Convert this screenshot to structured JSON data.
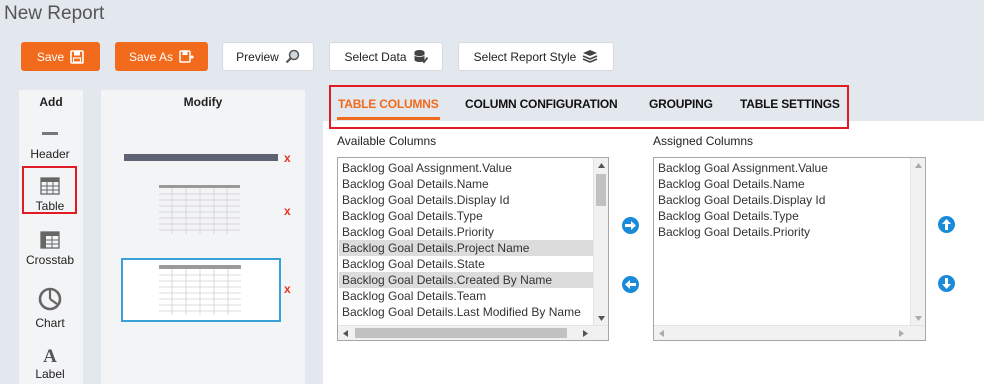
{
  "page": {
    "title": "New Report"
  },
  "toolbar": {
    "save_label": "Save",
    "save_as_label": "Save As",
    "preview_label": "Preview",
    "select_data_label": "Select Data",
    "select_style_label": "Select Report Style"
  },
  "add_panel": {
    "title": "Add",
    "items": [
      {
        "label": "Header",
        "icon": "header-icon"
      },
      {
        "label": "Table",
        "icon": "table-icon"
      },
      {
        "label": "Crosstab",
        "icon": "crosstab-icon"
      },
      {
        "label": "Chart",
        "icon": "chart-icon"
      },
      {
        "label": "Label",
        "icon": "label-icon"
      }
    ]
  },
  "modify_panel": {
    "title": "Modify",
    "remove_mark": "x"
  },
  "tabs": [
    {
      "label": "TABLE COLUMNS",
      "active": true
    },
    {
      "label": "COLUMN CONFIGURATION",
      "active": false
    },
    {
      "label": "GROUPING",
      "active": false
    },
    {
      "label": "TABLE SETTINGS",
      "active": false
    }
  ],
  "available": {
    "label": "Available Columns",
    "items": [
      {
        "text": "Backlog Goal Assignment.Value",
        "selected": false
      },
      {
        "text": "Backlog Goal Details.Name",
        "selected": false
      },
      {
        "text": "Backlog Goal Details.Display Id",
        "selected": false
      },
      {
        "text": "Backlog Goal Details.Type",
        "selected": false
      },
      {
        "text": "Backlog Goal Details.Priority",
        "selected": false
      },
      {
        "text": "Backlog Goal Details.Project Name",
        "selected": true
      },
      {
        "text": "Backlog Goal Details.State",
        "selected": false
      },
      {
        "text": "Backlog Goal Details.Created By Name",
        "selected": true
      },
      {
        "text": "Backlog Goal Details.Team",
        "selected": false
      },
      {
        "text": "Backlog Goal Details.Last Modified By Name",
        "selected": false
      }
    ]
  },
  "assigned": {
    "label": "Assigned Columns",
    "items": [
      "Backlog Goal Assignment.Value",
      "Backlog Goal Details.Name",
      "Backlog Goal Details.Display Id",
      "Backlog Goal Details.Type",
      "Backlog Goal Details.Priority"
    ]
  },
  "colors": {
    "accent": "#f26a1b",
    "highlight": "#e01b24",
    "blue": "#1a8bd8"
  }
}
